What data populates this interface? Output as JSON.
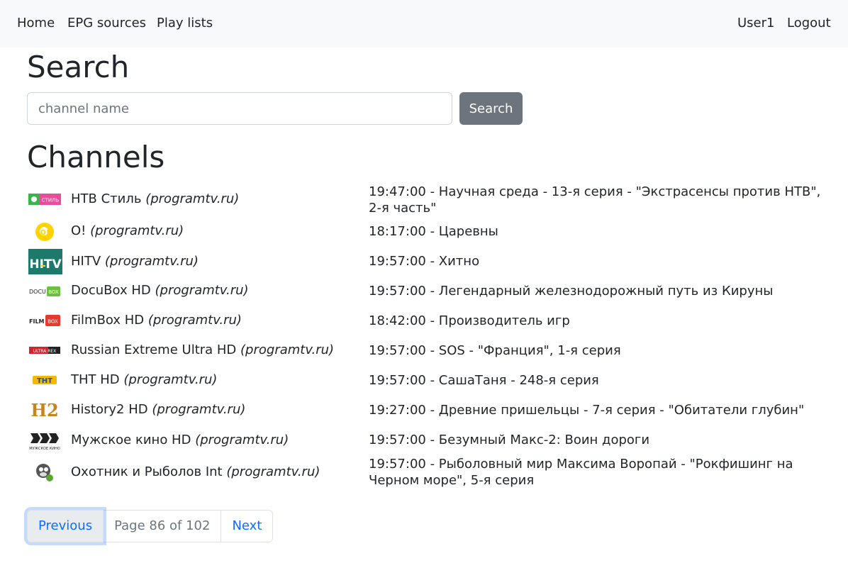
{
  "nav": {
    "home": "Home",
    "epg_sources": "EPG sources",
    "play_lists": "Play lists",
    "user": "User1",
    "logout": "Logout"
  },
  "search": {
    "heading": "Search",
    "placeholder": "channel name",
    "value": "",
    "button": "Search"
  },
  "channels": {
    "heading": "Channels",
    "rows": [
      {
        "name": "НТВ Стиль",
        "source": "(programtv.ru)",
        "program": "19:47:00 - Научная среда - 13-я серия - \"Экстрасенсы против НТВ\", 2-я часть\"",
        "logo_icon": "ntv-style-logo",
        "logo_text": "СТИЛЬ"
      },
      {
        "name": "O!",
        "source": "(programtv.ru)",
        "program": "18:17:00 - Царевны",
        "logo_icon": "o-channel-logo",
        "logo_text": "O!"
      },
      {
        "name": "HITV",
        "source": "(programtv.ru)",
        "program": "19:57:00 - Хитно",
        "logo_icon": "hitv-logo",
        "logo_text": "HITV"
      },
      {
        "name": "DocuBox HD",
        "source": "(programtv.ru)",
        "program": "19:57:00 - Легендарный железнодорожный путь из Кируны",
        "logo_icon": "docubox-logo",
        "logo_text": "DOCU"
      },
      {
        "name": "FilmBox HD",
        "source": "(programtv.ru)",
        "program": "18:42:00 - Производитель игр",
        "logo_icon": "filmbox-logo",
        "logo_text": "FILM"
      },
      {
        "name": "Russian Extreme Ultra HD",
        "source": "(programtv.ru)",
        "program": "19:57:00 - SOS - \"Франция\", 1-я серия",
        "logo_icon": "russian-extreme-logo",
        "logo_text": "ULTRA REX"
      },
      {
        "name": "ТНТ HD",
        "source": "(programtv.ru)",
        "program": "19:57:00 - СашаТаня - 248-я серия",
        "logo_icon": "tnt-logo",
        "logo_text": "ТНТ"
      },
      {
        "name": "History2 HD",
        "source": "(programtv.ru)",
        "program": "19:27:00 - Древние пришельцы - 7-я серия - \"Обитатели глубин\"",
        "logo_icon": "history2-logo",
        "logo_text": "H2"
      },
      {
        "name": "Мужское кино HD",
        "source": "(programtv.ru)",
        "program": "19:57:00 - Безумный Макс-2: Воин дороги",
        "logo_icon": "muzhskoe-kino-logo",
        "logo_text": "МУЖСКОЕ КИНО"
      },
      {
        "name": "Охотник и Рыболов Int",
        "source": "(programtv.ru)",
        "program": "19:57:00 - Рыболовный мир Максима Воропай - \"Рокфишинг на Черном море\", 5-я серия",
        "logo_icon": "ohotnik-rybolov-logo",
        "logo_text": ""
      }
    ]
  },
  "pagination": {
    "previous": "Previous",
    "info": "Page 86 of 102",
    "next": "Next"
  },
  "colors": {
    "navbar_bg": "#f8f9fa",
    "button_secondary": "#6c757d",
    "link": "#0d6efd"
  }
}
